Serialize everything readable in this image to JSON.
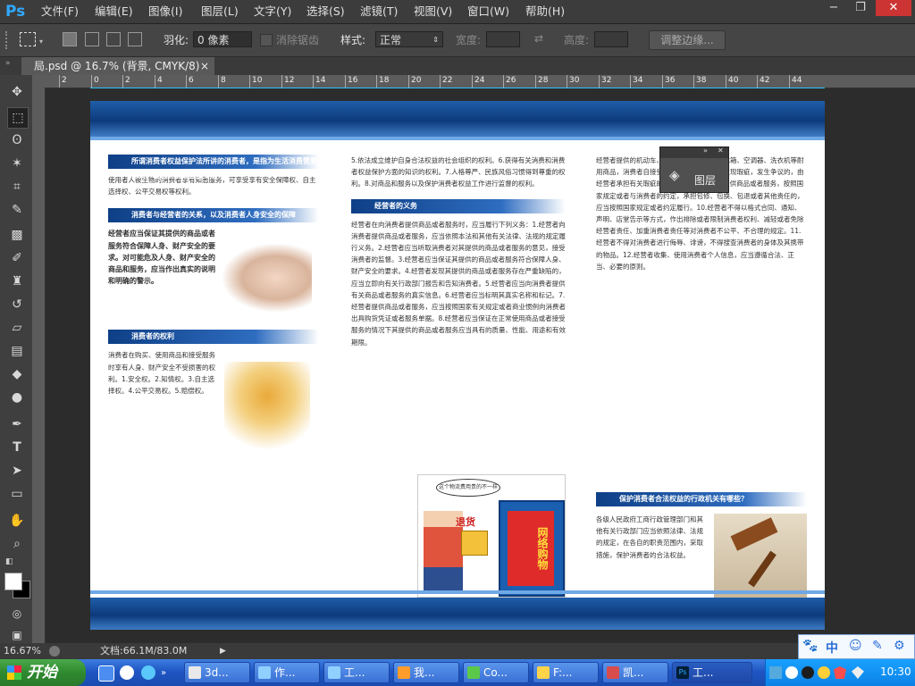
{
  "app": {
    "logo": "Ps"
  },
  "menu": [
    "文件(F)",
    "编辑(E)",
    "图像(I)",
    "图层(L)",
    "文字(Y)",
    "选择(S)",
    "滤镜(T)",
    "视图(V)",
    "窗口(W)",
    "帮助(H)"
  ],
  "window_controls": {
    "minimize": "−",
    "restore": "❐",
    "close": "✕"
  },
  "options": {
    "feather_label": "羽化:",
    "feather_value": "0 像素",
    "antialias_label": "消除锯齿",
    "style_label": "样式:",
    "style_value": "正常",
    "width_label": "宽度:",
    "height_label": "高度:",
    "refine_edge_button": "调整边缘..."
  },
  "document_tab": {
    "title": "局.psd @ 16.7% (背景, CMYK/8)",
    "close": "×"
  },
  "ruler_ticks": [
    "2",
    "0",
    "2",
    "4",
    "6",
    "8",
    "10",
    "12",
    "14",
    "16",
    "18",
    "20",
    "22",
    "24",
    "26",
    "28",
    "30",
    "32",
    "34",
    "36",
    "38",
    "40",
    "42",
    "44"
  ],
  "statusbar": {
    "zoom": "16.67%",
    "doc_size": "文档:66.1M/83.0M"
  },
  "layers_panel": {
    "label": "图层"
  },
  "brochure": {
    "col1": {
      "heading1": "所谓消费者权益保护法所讲的消费者，是指为生活消费需要购买、使用商品或者接受服务",
      "para1": "使用者人被生物的消费者享有知悉服务，可享受享有安全保障权、自主选择权、公平交易权等权利。",
      "heading2": "消费者与经营者的关系，以及消费者人身安全的保障",
      "para2": "经营者应当保证其提供的商品或者服务符合保障人身、财产安全的要求。对可能危及人身、财产安全的商品和服务，应当作出真实的说明和明确的警示。",
      "heading3": "消费者的权利",
      "para3": "消费者在购买、使用商品和接受服务时享有人身、财产安全不受损害的权利。1.安全权。2.知情权。3.自主选择权。4.公平交易权。5.赔偿权。"
    },
    "col2": {
      "para1": "5.依法成立维护自身合法权益的社会组织的权利。6.获得有关消费和消费者权益保护方面的知识的权利。7.人格尊严、民族风俗习惯得到尊重的权利。8.对商品和服务以及保护消费者权益工作进行监督的权利。",
      "heading1": "经营者的义务",
      "para2": "经营者在向消费者提供商品或者服务时，应当履行下列义务：1.经营者向消费者提供商品或者服务，应当依照本法和其他有关法律、法规的规定履行义务。2.经营者应当听取消费者对其提供的商品或者服务的意见，接受消费者的监督。3.经营者应当保证其提供的商品或者服务符合保障人身、财产安全的要求。4.经营者发现其提供的商品或者服务存在严重缺陷的，应当立即向有关行政部门报告和告知消费者。5.经营者应当向消费者提供有关商品或者服务的真实信息。6.经营者应当标明其真实名称和标记。7.经营者提供商品或者服务，应当按照国家有关规定或者商业惯例向消费者出具购货凭证或者服务单据。8.经营者应当保证在正常使用商品或者接受服务的情况下其提供的商品或者服务应当具有的质量、性能、用途和有效期限。"
    },
    "col3": {
      "para1": "经营者提供的机动车、计算机、电视机、电冰箱、空调器、洗衣机等耐用商品，消费者自接受商品之日起六个月内发现瑕疵，发生争议的，由经营者承担有关瑕疵的举证责任。9.经营者提供商品或者服务，按照国家规定或者与消费者的约定，承担包修、包换、包退或者其他责任的，应当按照国家规定或者约定履行。10.经营者不得以格式合同、通知、声明、店堂告示等方式，作出排除或者限制消费者权利、减轻或者免除经营者责任、加重消费者责任等对消费者不公平、不合理的规定。11.经营者不得对消费者进行侮辱、诽谤，不得搜查消费者的身体及其携带的物品。12.经营者收集、使用消费者个人信息，应当遵循合法、正当、必要的原则。",
      "heading1": "保护消费者合法权益的行政机关有哪些？",
      "para2": "各级人民政府工商行政管理部门和其他有关行政部门应当依照法律、法规的规定，在各自的职责范围内，采取措施，保护消费者的合法权益。"
    },
    "comic": {
      "bubble": "这个物流费用贵的不一样",
      "return_label": "退货",
      "shop_sign": "网络购物"
    }
  },
  "ime_bar": [
    "🐾",
    "中",
    "☺",
    "✎",
    "⚙"
  ],
  "taskbar": {
    "start": "开始",
    "tasks": [
      "3d...",
      "作...",
      "工...",
      "我...",
      "Co...",
      "F:...",
      "凯...",
      "工..."
    ],
    "clock": "10:30"
  }
}
